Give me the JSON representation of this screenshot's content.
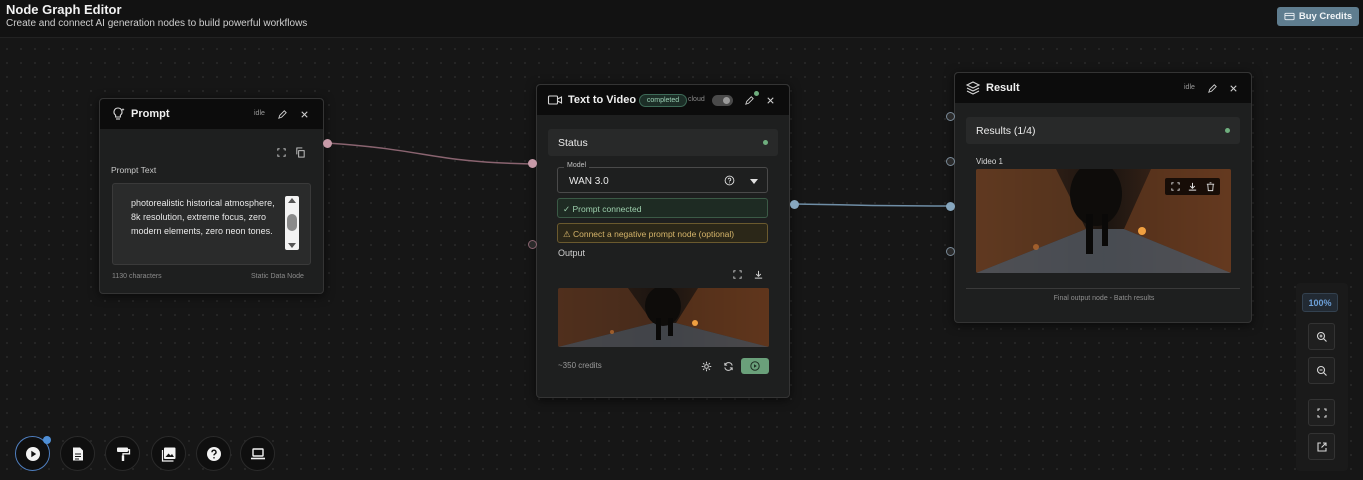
{
  "header": {
    "title": "Node Graph Editor",
    "subtitle": "Create and connect AI generation nodes to build powerful workflows",
    "buy_credits_label": "Buy Credits"
  },
  "prompt_node": {
    "title": "Prompt",
    "status": "idle",
    "field_label": "Prompt Text",
    "text": "photorealistic historical atmosphere, 8k resolution, extreme focus, zero modern elements, zero neon tones.",
    "char_count": "1130 characters",
    "node_type": "Static Data Node",
    "icon": "lightbulb-icon"
  },
  "video_node": {
    "title": "Text to Video",
    "badge": "completed",
    "cloud_label": "cloud",
    "cloud_enabled": false,
    "status_label": "Status",
    "model_label": "Model",
    "model_value": "WAN 3.0",
    "prompt_connected": "✓ Prompt connected",
    "negative_hint": "⚠ Connect a negative prompt node (optional)",
    "output_label": "Output",
    "credits": "~350 credits",
    "icon": "video-camera-icon"
  },
  "result_node": {
    "title": "Result",
    "status": "idle",
    "results_label": "Results (1/4)",
    "video_label": "Video 1",
    "footer": "Final output node - Batch results",
    "icon": "layers-icon"
  },
  "zoom": {
    "level": "100%"
  },
  "toolbar": {
    "items": [
      "play-icon",
      "document-icon",
      "paint-roller-icon",
      "gallery-icon",
      "help-icon",
      "laptop-icon"
    ]
  },
  "colors": {
    "accent_blue": "#4f8fd6",
    "success_green": "#6fae7e",
    "warning_amber": "#d6b56a",
    "wire_prompt": "#8a6470",
    "wire_video": "#6f8ea6"
  }
}
